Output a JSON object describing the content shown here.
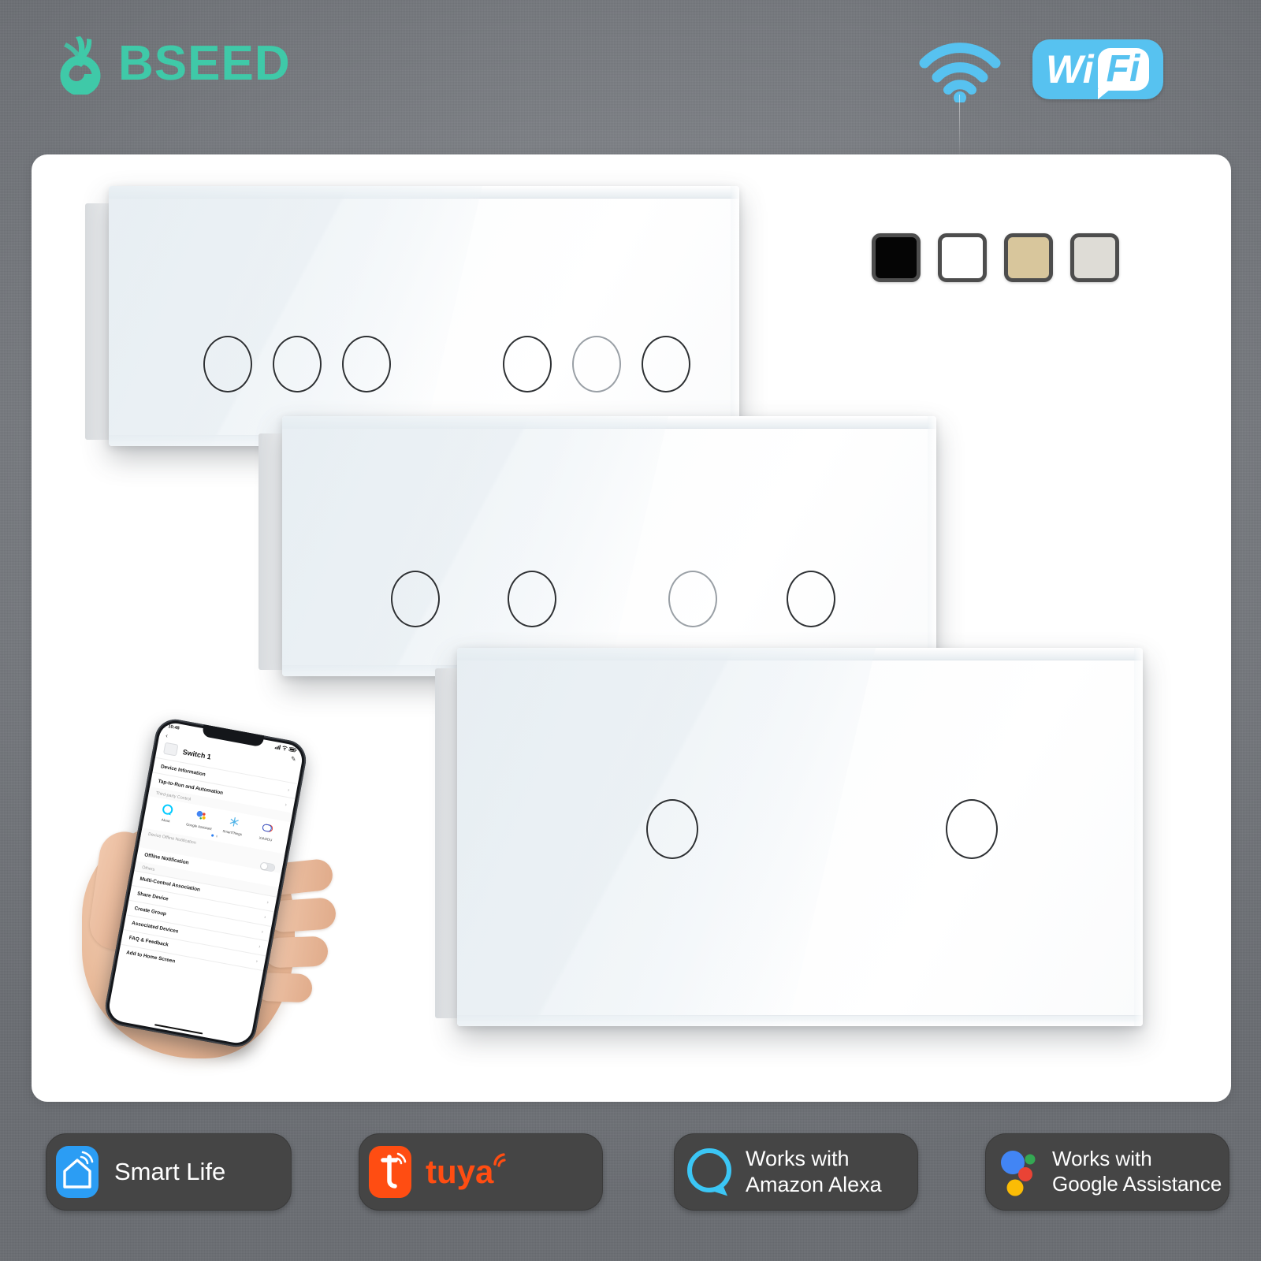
{
  "brand": {
    "name": "BSEED",
    "logo_color": "#3FC9A8",
    "logo_icon": "bseed-sprout-logo"
  },
  "header": {
    "wifi_icon": "wifi-signal-icon",
    "wifi_icon_color": "#57C2F0",
    "wifi_badge": {
      "part1": "Wi",
      "part2": "Fi",
      "color": "#57C2F0"
    }
  },
  "colors": {
    "background_grey": "#7E8186",
    "card_white": "#FFFFFF",
    "badge_dark": "#454545"
  },
  "swatches": [
    {
      "name": "black",
      "hex": "#050505"
    },
    {
      "name": "white",
      "hex": "#FFFFFF"
    },
    {
      "name": "gold",
      "hex": "#D8C69C"
    },
    {
      "name": "grey",
      "hex": "#DEDCD6"
    }
  ],
  "products": [
    {
      "name": "6-gang-touch-switch-panel",
      "gangs": 6,
      "groups": [
        3,
        3
      ]
    },
    {
      "name": "4-gang-touch-switch-panel",
      "gangs": 4,
      "groups": [
        2,
        2
      ]
    },
    {
      "name": "2-gang-touch-switch-panel",
      "gangs": 2,
      "groups": [
        1,
        1
      ]
    }
  ],
  "phone": {
    "status_time": "10:48",
    "battery_icon": "battery-icon",
    "wifi_icon": "wifi-icon",
    "signal_icon": "cellular-signal-icon",
    "back_icon": "back-chevron-icon",
    "edit_icon": "edit-pencil-icon",
    "device_title": "Switch 1",
    "rows_top": [
      "Device Information",
      "Tap-to-Run and Automation"
    ],
    "section_third_party": "Third-party Control",
    "third_party": [
      {
        "label": "Alexa",
        "icon": "alexa-ring-icon"
      },
      {
        "label": "Google Assistant",
        "icon": "google-assistant-icon"
      },
      {
        "label": "SmartThings",
        "icon": "smartthings-icon"
      },
      {
        "label": "XIAODU",
        "icon": "xiaodu-icon"
      }
    ],
    "section_offline": "Device Offline Notification",
    "offline_row": "Offline Notification",
    "section_others": "Others",
    "rows_others": [
      "Multi-Control Association",
      "Share Device",
      "Create Group",
      "Associated Devices",
      "FAQ & Feedback",
      "Add to Home Screen"
    ]
  },
  "badges": [
    {
      "name": "smart-life",
      "icon": "smart-life-house-icon",
      "icon_color": "#2B9DF4",
      "line1": "Smart Life",
      "line2": ""
    },
    {
      "name": "tuya",
      "icon": "tuya-t-icon",
      "icon_color": "#FF4D12",
      "line1": "tuya",
      "line2": ""
    },
    {
      "name": "amazon-alexa",
      "icon": "alexa-ring-icon",
      "icon_color": "#3BC6F5",
      "line1": "Works with",
      "line2": "Amazon Alexa"
    },
    {
      "name": "google-assistance",
      "icon": "google-assistant-dots-icon",
      "icon_color": "#4285F4",
      "line1": "Works with",
      "line2": "Google Assistance"
    }
  ]
}
